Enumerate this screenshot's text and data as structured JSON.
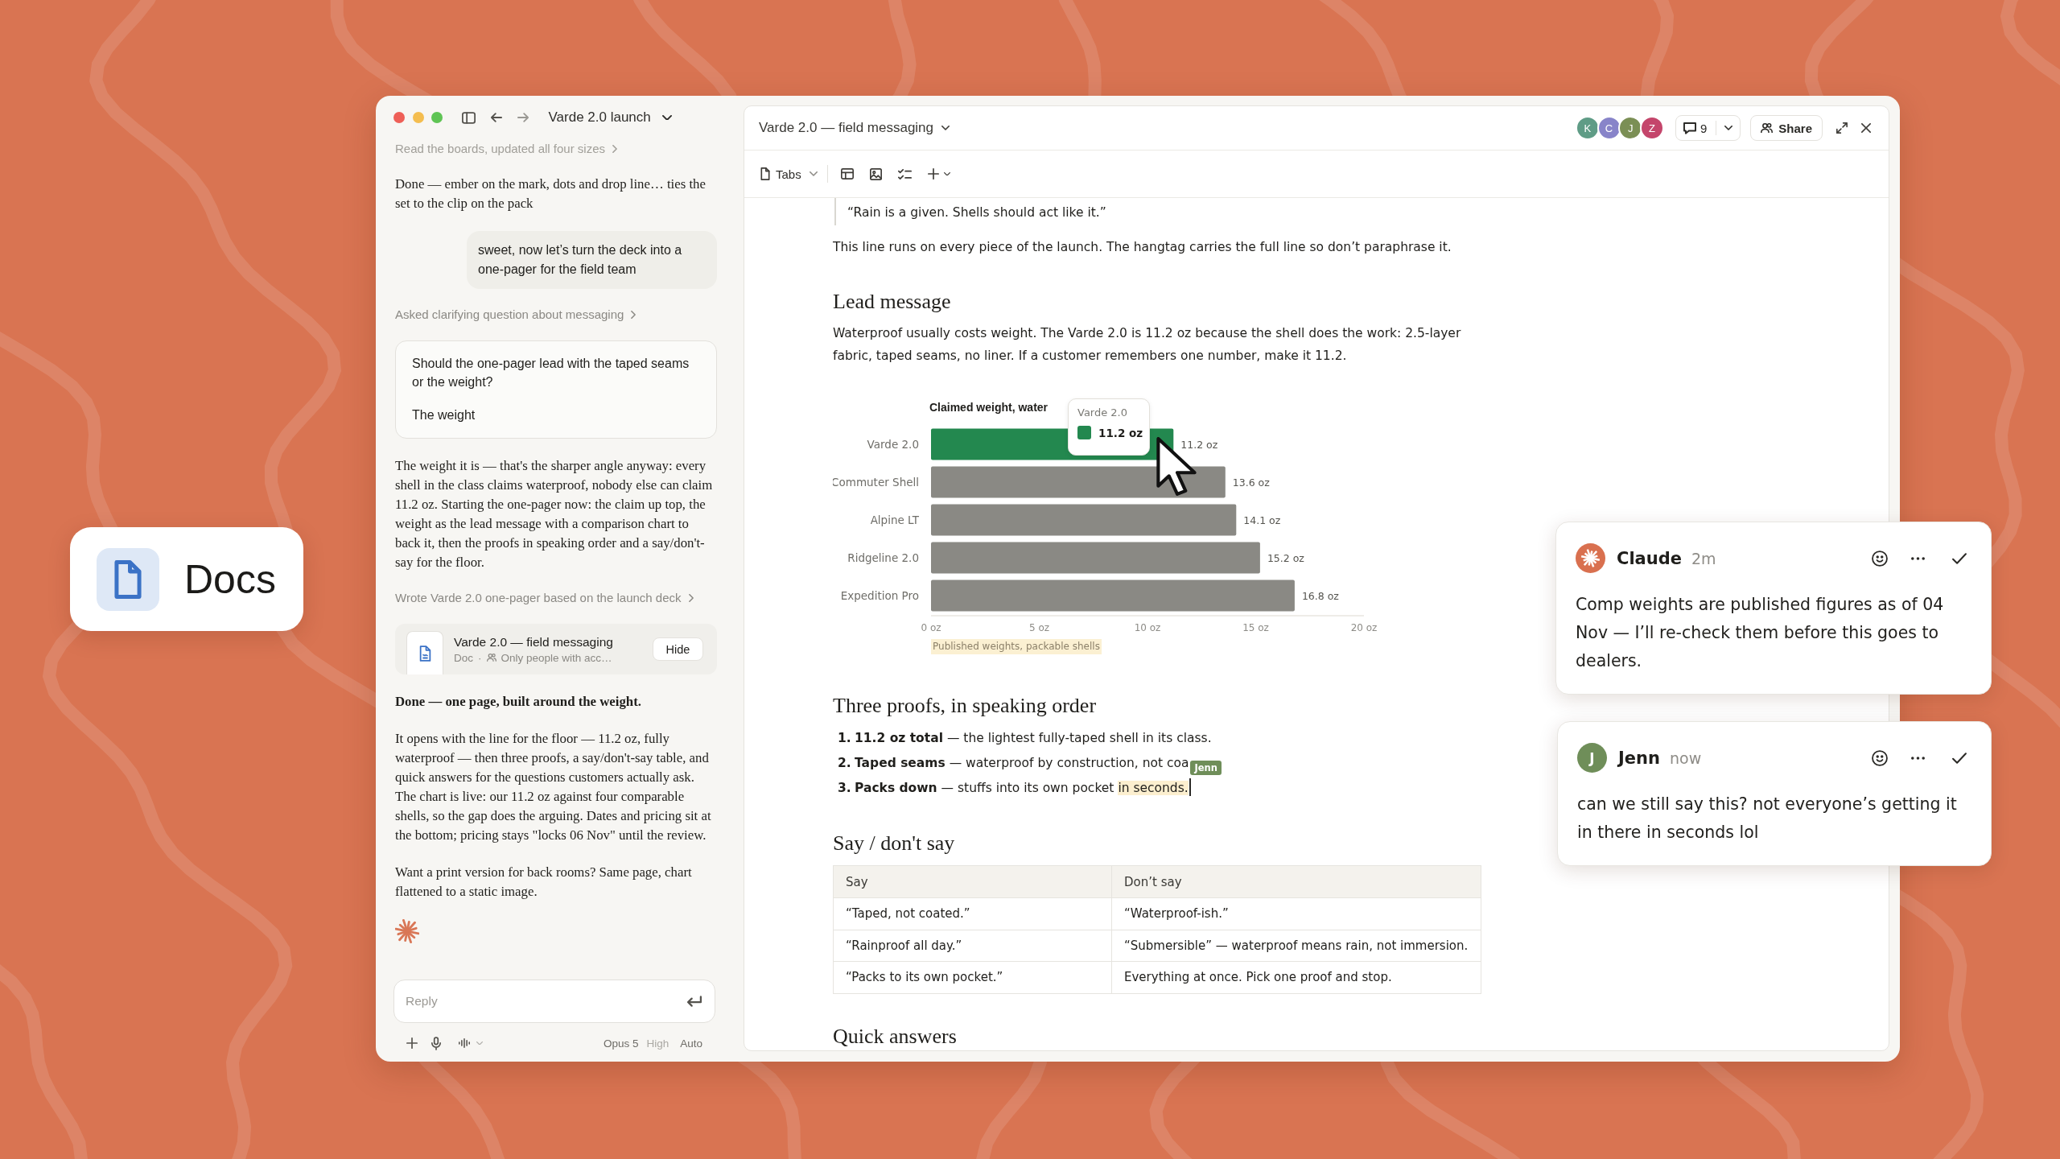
{
  "badge": {
    "label": "Docs"
  },
  "chat": {
    "title": "Varde 2.0 launch",
    "messages": [
      {
        "kind": "step",
        "text": "Read the boards, updated all four sizes",
        "faded": true
      },
      {
        "kind": "assistant",
        "text": "Done — ember on the mark, dots and drop line… ties the set to the clip on the pack",
        "bold": false
      },
      {
        "kind": "user",
        "text": "sweet, now let’s turn the deck into a one-pager for the field team"
      },
      {
        "kind": "step",
        "text": "Asked clarifying question about messaging",
        "faded": false
      },
      {
        "kind": "question",
        "question": "Should the one-pager lead with the taped seams or the weight?",
        "answer": "The weight"
      },
      {
        "kind": "assistant",
        "text": "The weight it is — that's the sharper angle anyway: every shell in the class claims waterproof, nobody else can claim 11.2 oz. Starting the one-pager now: the claim up top, the weight as the lead message with a comparison chart to back it, then the proofs in speaking order and a say/don't-say for the floor.",
        "bold": false
      },
      {
        "kind": "step",
        "text": "Wrote Varde 2.0 one-pager based on the launch deck",
        "faded": false
      },
      {
        "kind": "doc",
        "title": "Varde 2.0 — field messaging",
        "type": "Doc",
        "separator": "·",
        "access": "Only people with acc…",
        "button": "Hide"
      },
      {
        "kind": "assistant",
        "text": "Done — one page, built around the weight.",
        "bold": true
      },
      {
        "kind": "assistant",
        "text": "It opens with the line for the floor — 11.2 oz, fully waterproof — then three proofs, a say/don't-say table, and quick answers for the questions customers actually ask. The chart is live: our 11.2 oz against four comparable shells, so the gap does the arguing. Dates and pricing sit at the bottom; pricing stays \"locks 06 Nov\" until the review.",
        "bold": false
      },
      {
        "kind": "assistant",
        "text": "Want a print version for back rooms? Same page, chart flattened to a static image.",
        "bold": false
      },
      {
        "kind": "spark"
      }
    ],
    "reply": {
      "placeholder": "Reply"
    },
    "composer": {
      "model": "Opus 5",
      "effort": "High",
      "mode": "Auto"
    }
  },
  "doc": {
    "title": "Varde 2.0 — field messaging",
    "collaborators": [
      {
        "initial": "K",
        "color": "#5f9c86"
      },
      {
        "initial": "C",
        "color": "#8884c9"
      },
      {
        "initial": "J",
        "color": "#7b8f55"
      },
      {
        "initial": "Z",
        "color": "#c4456b"
      }
    ],
    "comment_count": "9",
    "share": "Share",
    "toolbar": {
      "tabs": "Tabs"
    },
    "blocks": [
      {
        "kind": "quote",
        "text": "“Rain is a given. Shells should act like it.”"
      },
      {
        "kind": "paragraph",
        "text": "This line runs on every piece of the launch. The hangtag carries the full line so don’t paraphrase it."
      },
      {
        "kind": "heading",
        "text": "Lead message"
      },
      {
        "kind": "paragraph",
        "text": "Waterproof usually costs weight. The Varde 2.0 is 11.2 oz because the shell does the work: 2.5-layer fabric, taped seams, no liner. If a customer remembers one number, make it 11.2."
      },
      {
        "kind": "chart",
        "chart_data": {
          "type": "bar",
          "orientation": "horizontal",
          "title": "Claimed weight, water",
          "categories": [
            "Varde 2.0",
            "Commuter Shell",
            "Alpine LT",
            "Ridgeline 2.0",
            "Expedition Pro"
          ],
          "stacked": true,
          "series": [
            {
              "color": "#23884f",
              "values": [
                11.2,
                null,
                null,
                null,
                null
              ]
            },
            {
              "color": "#8a8984",
              "values": [
                null,
                13.6,
                14.1,
                15.2,
                16.8
              ]
            }
          ],
          "value_labels": [
            "11.2 oz",
            "13.6 oz",
            "14.1 oz",
            "15.2 oz",
            "16.8 oz"
          ],
          "xlim": [
            0,
            20
          ],
          "xticks": [
            {
              "value": 0,
              "label": "0 oz"
            },
            {
              "value": 5,
              "label": "5 oz"
            },
            {
              "value": 10,
              "label": "10 oz"
            },
            {
              "value": 15,
              "label": "15 oz"
            },
            {
              "value": 20,
              "label": "20 oz"
            }
          ]
        },
        "note": "Published weights, packable shells",
        "tooltip": {
          "title": "Varde 2.0",
          "value": "11.2 oz",
          "color": "#23884f"
        }
      },
      {
        "kind": "heading",
        "text": "Three proofs, in speaking order"
      },
      {
        "kind": "list",
        "items": [
          {
            "number": "1.",
            "text": "**11.2 oz total** — the lightest fully-taped shell in its class.",
            "caret": false
          },
          {
            "number": "2.",
            "text": "**Taped seams** — waterproof by construction, not coa",
            "cursor": {
              "name": "Jenn",
              "color": "#6f8e59"
            },
            "caret": false
          },
          {
            "number": "3.",
            "text": "**Packs down** — stuffs into its own pocket ",
            "highlight": "in seconds.",
            "caret": true
          }
        ]
      },
      {
        "kind": "heading",
        "text": "Say / don't say"
      },
      {
        "kind": "table",
        "columns": [
          "Say",
          "Don’t say"
        ],
        "rows": [
          [
            "“Taped, not coated.”",
            "“Waterproof-ish.”"
          ],
          [
            "“Rainproof all day.”",
            "“Submersible” — waterproof means rain, not immersion."
          ],
          [
            "“Packs to its own pocket.”",
            "Everything at once. Pick one proof and stop."
          ]
        ]
      },
      {
        "kind": "heading",
        "text": "Quick answers"
      }
    ]
  },
  "comments": [
    {
      "author": "Claude",
      "time": "2m",
      "text": "Comp weights are published figures as of 04 Nov — I’ll re-check them before this goes to dealers.",
      "avatar": {
        "kind": "spark",
        "color": "#d9704f"
      }
    },
    {
      "author": "Jenn",
      "time": "now",
      "text": "can we still say this? not everyone’s getting it in there in seconds lol",
      "avatar": {
        "kind": "initial",
        "initial": "J",
        "color": "#6f8e59"
      }
    }
  ]
}
